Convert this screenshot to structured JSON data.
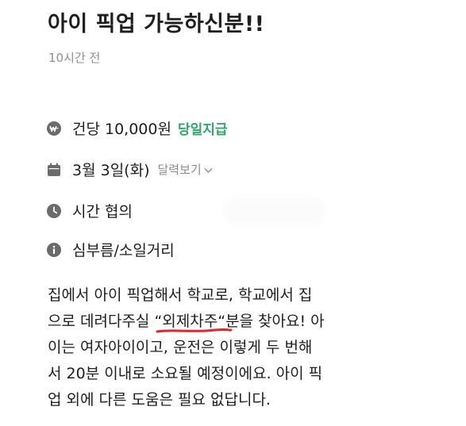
{
  "post": {
    "title": "아이 픽업 가능하신분!!",
    "time_ago": "10시간 전"
  },
  "details": {
    "pay": {
      "icon": "won-icon",
      "text": "건당 10,000원",
      "badge": "당일지급",
      "badge_color": "#2ea86a"
    },
    "date": {
      "icon": "calendar-icon",
      "text": "3월 3일(화)",
      "calendar_link": "달력보기"
    },
    "time": {
      "icon": "clock-icon",
      "text": "시간 협의"
    },
    "place": {
      "icon": "info-icon",
      "text": "심부름/소일거리"
    }
  },
  "description": {
    "line1": "집에서 아이 픽업해서 학교로, 학교에서 집",
    "line2_before": "으로 데려다주실 ",
    "line2_highlight": "“외제차주“",
    "line2_after": "분을 찾아요! 아",
    "line3": "이는 여자아이이고, 운전은 이렇게 두 번해",
    "line4": "서 20분 이내로 소요될 예정이에요. 아이 픽",
    "line5": "업 외에 다른 도움은 필요 없답니다.",
    "highlight_underline_color": "#e0262b"
  }
}
